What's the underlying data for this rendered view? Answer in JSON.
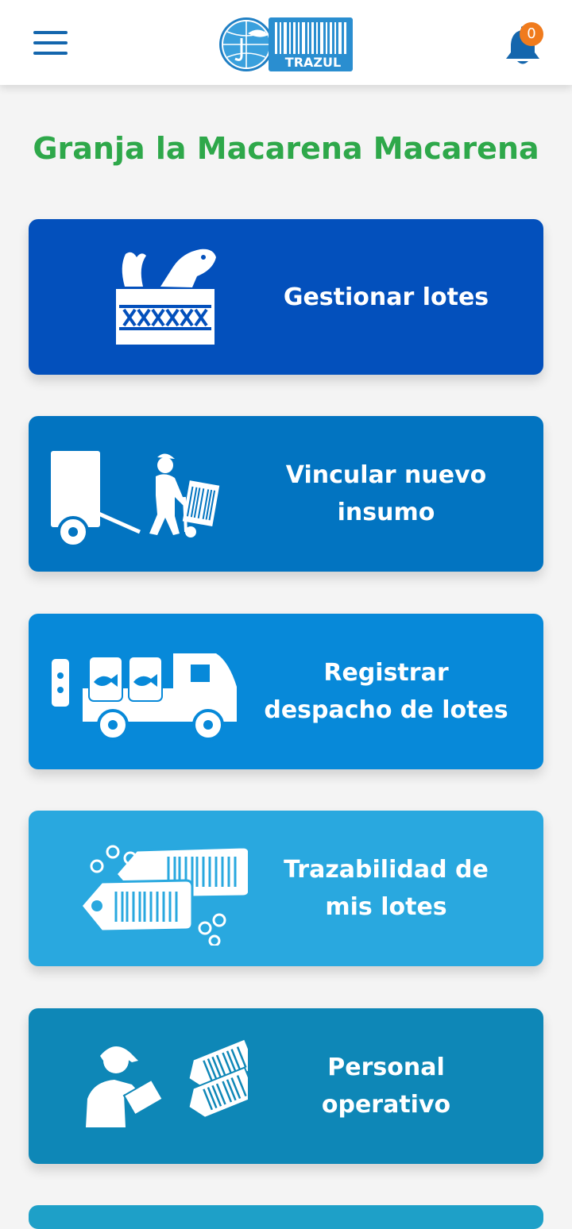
{
  "header": {
    "logo_text": "TRAZUL",
    "notification_count": "0",
    "brand_colors": {
      "primary": "#1466ad",
      "badge": "#f07b1d"
    }
  },
  "farm_name": "Granja la Macarena Macarena",
  "menu": [
    {
      "label": "Gestionar lotes",
      "icon": "fish-crate-icon",
      "color": "#0350bc"
    },
    {
      "label": "Vincular nuevo insumo",
      "icon": "delivery-worker-icon",
      "color": "#0274c1"
    },
    {
      "label": "Registrar despacho de lotes",
      "icon": "fish-truck-icon",
      "color": "#0789d9"
    },
    {
      "label": "Trazabilidad de mis lotes",
      "icon": "barcode-tags-icon",
      "color": "#29a8df"
    },
    {
      "label": "Personal operativo",
      "icon": "operator-tags-icon",
      "color": "#0e87b7"
    }
  ]
}
